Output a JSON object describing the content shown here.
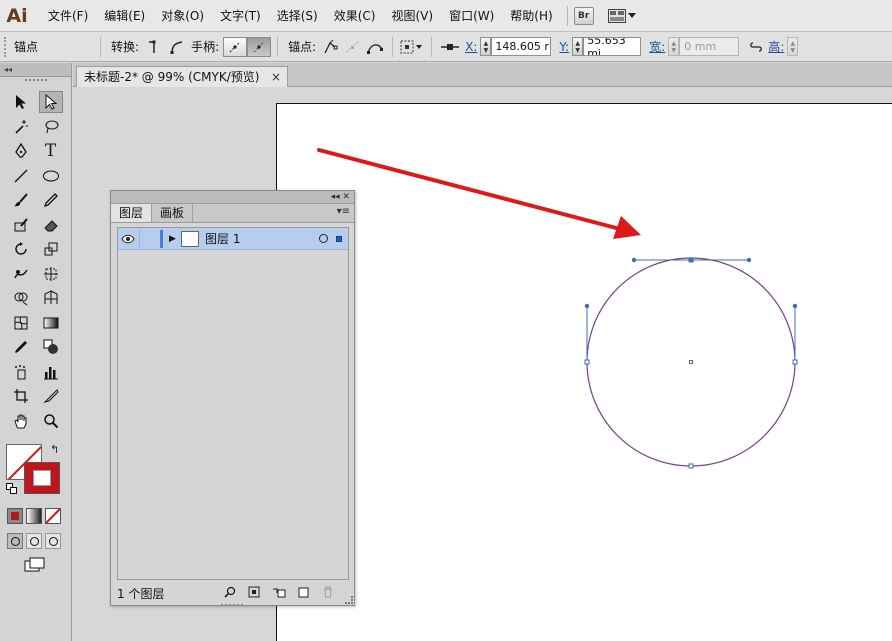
{
  "app": {
    "logo": "Ai",
    "menus": [
      "文件(F)",
      "编辑(E)",
      "对象(O)",
      "文字(T)",
      "选择(S)",
      "效果(C)",
      "视图(V)",
      "窗口(W)",
      "帮助(H)"
    ],
    "bridge_label": "Br"
  },
  "controlbar": {
    "selection_label": "锚点",
    "convert_label": "转换:",
    "handles_label": "手柄:",
    "anchors_label": "锚点:",
    "x_label": "X:",
    "x_value": "148.605 r",
    "y_label": "Y:",
    "y_value": "55.653 mi",
    "width_label": "宽:",
    "width_value": "0 mm",
    "height_label": "高:"
  },
  "document": {
    "tab_title": "未标题-2* @ 99% (CMYK/预览)",
    "tab_close": "×"
  },
  "layers_panel": {
    "tabs": [
      "图层",
      "画板"
    ],
    "layer_name": "图层 1",
    "footer_count": "1 个图层",
    "header_controls": "◂◂ ✕"
  },
  "colors": {
    "path_stroke": "#7b3f8c",
    "selection_blue": "#3a6fb7",
    "arrow_red": "#e01818",
    "stroke_swatch": "#c0151d",
    "layer_row": "#b7cdee"
  },
  "icons": [
    "selection-tool-icon",
    "direct-selection-tool-icon",
    "pen-tool-icon",
    "type-tool-icon",
    "eye-icon",
    "search-icon",
    "trash-icon"
  ]
}
